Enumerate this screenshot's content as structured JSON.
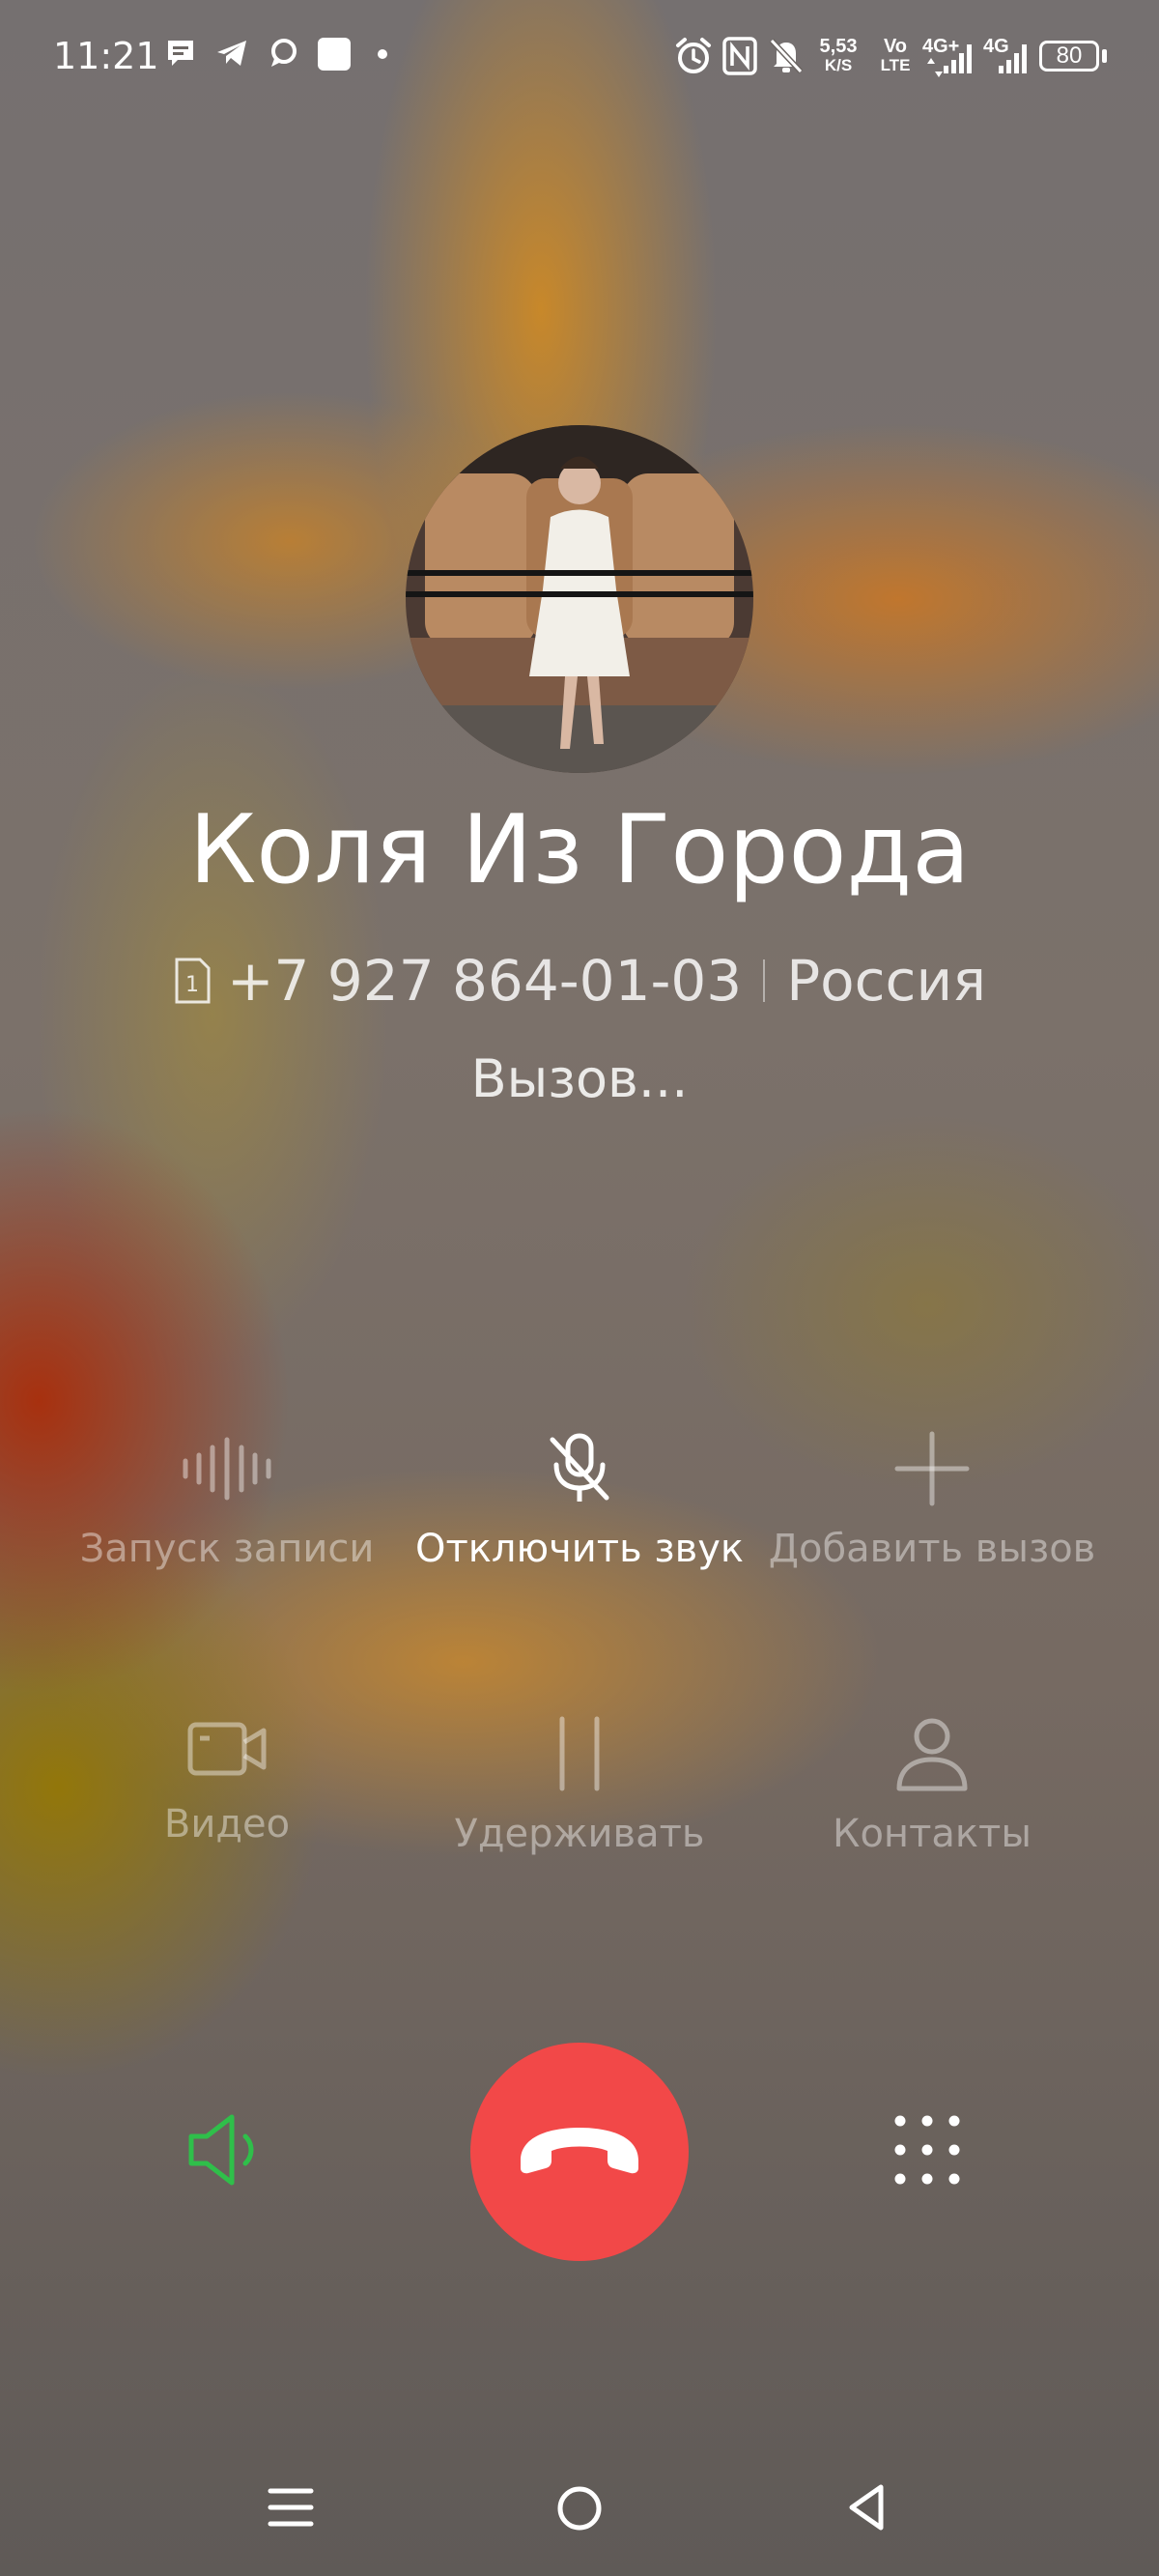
{
  "status_bar": {
    "time": "11:21",
    "network_speed_value": "5,53",
    "network_speed_unit": "K/S",
    "volte_top": "Vo",
    "volte_bottom": "LTE",
    "signal1_label": "4G+",
    "signal2_label": "4G",
    "battery_level": "80",
    "icons": [
      "message-icon",
      "telegram-icon",
      "chat-bubble-icon",
      "app-square-icon",
      "dot-icon",
      "alarm-icon",
      "nfc-icon",
      "bell-muted-icon",
      "signal-icon",
      "battery-icon"
    ]
  },
  "contact": {
    "name": "Коля Из Города",
    "sim_slot": "1",
    "phone_number": "+7 927 864-01-03",
    "country": "Россия",
    "call_status": "Вызов..."
  },
  "actions": {
    "record": {
      "label": "Запуск записи",
      "icon": "waveform-icon",
      "enabled": false
    },
    "mute": {
      "label": "Отключить звук",
      "icon": "mic-off-icon",
      "enabled": true
    },
    "add_call": {
      "label": "Добавить вызов",
      "icon": "plus-icon",
      "enabled": false
    },
    "video": {
      "label": "Видео",
      "icon": "video-camera-icon",
      "enabled": false
    },
    "hold": {
      "label": "Удерживать",
      "icon": "pause-icon",
      "enabled": false
    },
    "contacts": {
      "label": "Контакты",
      "icon": "person-icon",
      "enabled": false
    }
  },
  "controls": {
    "speaker": {
      "icon": "speaker-icon",
      "active": true,
      "color": "#2fbf4a"
    },
    "end_call": {
      "icon": "hang-up-icon",
      "color": "#f24848"
    },
    "keypad": {
      "icon": "dialpad-icon"
    }
  },
  "nav_bar": {
    "icons": [
      "menu-icon",
      "home-icon",
      "back-icon"
    ]
  }
}
